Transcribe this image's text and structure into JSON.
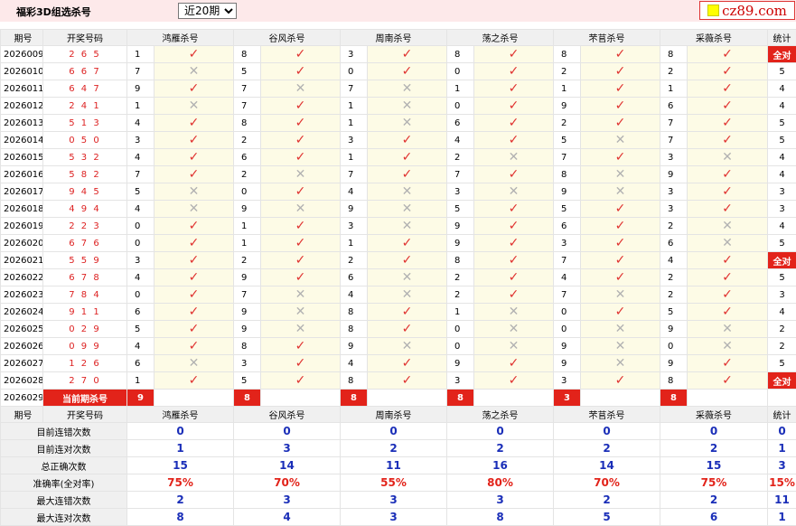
{
  "title": "福彩3D组选杀号",
  "period_select": "近20期",
  "logo": "cz89.com",
  "header": {
    "qihao": "期号",
    "draw": "开奖号码",
    "stat": "统计"
  },
  "experts": [
    "鸿雁杀号",
    "谷风杀号",
    "周南杀号",
    "荡之杀号",
    "芣苢杀号",
    "采薇杀号"
  ],
  "marks": {
    "ok": "✓",
    "no": "✕"
  },
  "rows": [
    {
      "q": "2026009",
      "d": "2 6 5",
      "k": [
        [
          "1",
          "o"
        ],
        [
          "8",
          "o"
        ],
        [
          "3",
          "o"
        ],
        [
          "8",
          "o"
        ],
        [
          "8",
          "o"
        ],
        [
          "8",
          "o"
        ]
      ],
      "s": "全对"
    },
    {
      "q": "2026010",
      "d": "6 6 7",
      "k": [
        [
          "7",
          "x"
        ],
        [
          "5",
          "o"
        ],
        [
          "0",
          "o"
        ],
        [
          "0",
          "o"
        ],
        [
          "2",
          "o"
        ],
        [
          "2",
          "o"
        ]
      ],
      "s": "5"
    },
    {
      "q": "2026011",
      "d": "6 4 7",
      "k": [
        [
          "9",
          "o"
        ],
        [
          "7",
          "x"
        ],
        [
          "7",
          "x"
        ],
        [
          "1",
          "o"
        ],
        [
          "1",
          "o"
        ],
        [
          "1",
          "o"
        ]
      ],
      "s": "4"
    },
    {
      "q": "2026012",
      "d": "2 4 1",
      "k": [
        [
          "1",
          "x"
        ],
        [
          "7",
          "o"
        ],
        [
          "1",
          "x"
        ],
        [
          "0",
          "o"
        ],
        [
          "9",
          "o"
        ],
        [
          "6",
          "o"
        ]
      ],
      "s": "4"
    },
    {
      "q": "2026013",
      "d": "5 1 3",
      "k": [
        [
          "4",
          "o"
        ],
        [
          "8",
          "o"
        ],
        [
          "1",
          "x"
        ],
        [
          "6",
          "o"
        ],
        [
          "2",
          "o"
        ],
        [
          "7",
          "o"
        ]
      ],
      "s": "5"
    },
    {
      "q": "2026014",
      "d": "0 5 0",
      "k": [
        [
          "3",
          "o"
        ],
        [
          "2",
          "o"
        ],
        [
          "3",
          "o"
        ],
        [
          "4",
          "o"
        ],
        [
          "5",
          "x"
        ],
        [
          "7",
          "o"
        ]
      ],
      "s": "5"
    },
    {
      "q": "2026015",
      "d": "5 3 2",
      "k": [
        [
          "4",
          "o"
        ],
        [
          "6",
          "o"
        ],
        [
          "1",
          "o"
        ],
        [
          "2",
          "x"
        ],
        [
          "7",
          "o"
        ],
        [
          "3",
          "x"
        ]
      ],
      "s": "4"
    },
    {
      "q": "2026016",
      "d": "5 8 2",
      "k": [
        [
          "7",
          "o"
        ],
        [
          "2",
          "x"
        ],
        [
          "7",
          "o"
        ],
        [
          "7",
          "o"
        ],
        [
          "8",
          "x"
        ],
        [
          "9",
          "o"
        ]
      ],
      "s": "4"
    },
    {
      "q": "2026017",
      "d": "9 4 5",
      "k": [
        [
          "5",
          "x"
        ],
        [
          "0",
          "o"
        ],
        [
          "4",
          "x"
        ],
        [
          "3",
          "x"
        ],
        [
          "9",
          "x"
        ],
        [
          "3",
          "o"
        ]
      ],
      "s": "3"
    },
    {
      "q": "2026018",
      "d": "4 9 4",
      "k": [
        [
          "4",
          "x"
        ],
        [
          "9",
          "x"
        ],
        [
          "9",
          "x"
        ],
        [
          "5",
          "o"
        ],
        [
          "5",
          "o"
        ],
        [
          "3",
          "o"
        ]
      ],
      "s": "3"
    },
    {
      "q": "2026019",
      "d": "2 2 3",
      "k": [
        [
          "0",
          "o"
        ],
        [
          "1",
          "o"
        ],
        [
          "3",
          "x"
        ],
        [
          "9",
          "o"
        ],
        [
          "6",
          "o"
        ],
        [
          "2",
          "x"
        ]
      ],
      "s": "4"
    },
    {
      "q": "2026020",
      "d": "6 7 6",
      "k": [
        [
          "0",
          "o"
        ],
        [
          "1",
          "o"
        ],
        [
          "1",
          "o"
        ],
        [
          "9",
          "o"
        ],
        [
          "3",
          "o"
        ],
        [
          "6",
          "x"
        ]
      ],
      "s": "5"
    },
    {
      "q": "2026021",
      "d": "5 5 9",
      "k": [
        [
          "3",
          "o"
        ],
        [
          "2",
          "o"
        ],
        [
          "2",
          "o"
        ],
        [
          "8",
          "o"
        ],
        [
          "7",
          "o"
        ],
        [
          "4",
          "o"
        ]
      ],
      "s": "全对"
    },
    {
      "q": "2026022",
      "d": "6 7 8",
      "k": [
        [
          "4",
          "o"
        ],
        [
          "9",
          "o"
        ],
        [
          "6",
          "x"
        ],
        [
          "2",
          "o"
        ],
        [
          "4",
          "o"
        ],
        [
          "2",
          "o"
        ]
      ],
      "s": "5"
    },
    {
      "q": "2026023",
      "d": "7 8 4",
      "k": [
        [
          "0",
          "o"
        ],
        [
          "7",
          "x"
        ],
        [
          "4",
          "x"
        ],
        [
          "2",
          "o"
        ],
        [
          "7",
          "x"
        ],
        [
          "2",
          "o"
        ]
      ],
      "s": "3"
    },
    {
      "q": "2026024",
      "d": "9 1 1",
      "k": [
        [
          "6",
          "o"
        ],
        [
          "9",
          "x"
        ],
        [
          "8",
          "o"
        ],
        [
          "1",
          "x"
        ],
        [
          "0",
          "o"
        ],
        [
          "5",
          "o"
        ]
      ],
      "s": "4"
    },
    {
      "q": "2026025",
      "d": "0 2 9",
      "k": [
        [
          "5",
          "o"
        ],
        [
          "9",
          "x"
        ],
        [
          "8",
          "o"
        ],
        [
          "0",
          "x"
        ],
        [
          "0",
          "x"
        ],
        [
          "9",
          "x"
        ]
      ],
      "s": "2"
    },
    {
      "q": "2026026",
      "d": "0 9 9",
      "k": [
        [
          "4",
          "o"
        ],
        [
          "8",
          "o"
        ],
        [
          "9",
          "x"
        ],
        [
          "0",
          "x"
        ],
        [
          "9",
          "x"
        ],
        [
          "0",
          "x"
        ]
      ],
      "s": "2"
    },
    {
      "q": "2026027",
      "d": "1 2 6",
      "k": [
        [
          "6",
          "x"
        ],
        [
          "3",
          "o"
        ],
        [
          "4",
          "o"
        ],
        [
          "9",
          "o"
        ],
        [
          "9",
          "x"
        ],
        [
          "9",
          "o"
        ]
      ],
      "s": "5"
    },
    {
      "q": "2026028",
      "d": "2 7 0",
      "k": [
        [
          "1",
          "o"
        ],
        [
          "5",
          "o"
        ],
        [
          "8",
          "o"
        ],
        [
          "3",
          "o"
        ],
        [
          "3",
          "o"
        ],
        [
          "8",
          "o"
        ]
      ],
      "s": "全对"
    }
  ],
  "current": {
    "q": "2026029",
    "label": "当前期杀号",
    "kills": [
      "9",
      "8",
      "8",
      "8",
      "3",
      "8"
    ]
  },
  "stats": [
    {
      "label": "目前连错次数",
      "v": [
        "0",
        "0",
        "0",
        "0",
        "0",
        "0"
      ],
      "s": "0",
      "red": false
    },
    {
      "label": "目前连对次数",
      "v": [
        "1",
        "3",
        "2",
        "2",
        "2",
        "2"
      ],
      "s": "1",
      "red": false
    },
    {
      "label": "总正确次数",
      "v": [
        "15",
        "14",
        "11",
        "16",
        "14",
        "15"
      ],
      "s": "3",
      "red": false
    },
    {
      "label": "准确率(全对率)",
      "v": [
        "75%",
        "70%",
        "55%",
        "80%",
        "70%",
        "75%"
      ],
      "s": "15%",
      "red": true
    },
    {
      "label": "最大连错次数",
      "v": [
        "2",
        "3",
        "3",
        "3",
        "2",
        "2"
      ],
      "s": "11",
      "red": false
    },
    {
      "label": "最大连对次数",
      "v": [
        "8",
        "4",
        "3",
        "8",
        "5",
        "6"
      ],
      "s": "1",
      "red": false
    }
  ]
}
